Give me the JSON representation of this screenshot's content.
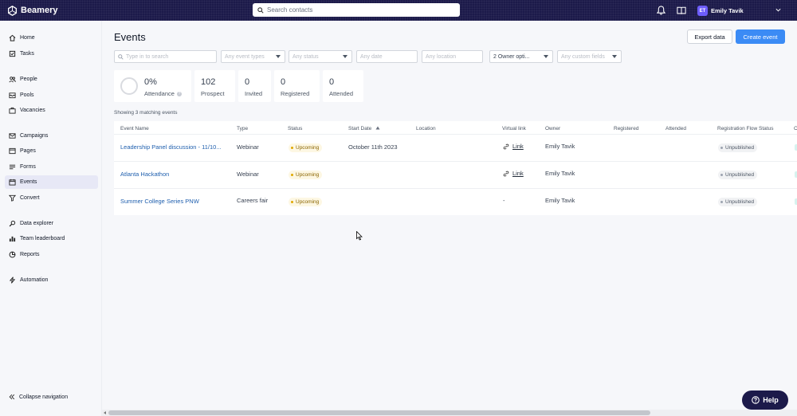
{
  "app": {
    "brand": "Beamery",
    "search_placeholder": "Search contacts",
    "user_initials": "ET",
    "user_name": "Emily Tavik"
  },
  "sidebar": {
    "items": [
      {
        "label": "Home",
        "icon": "home-icon"
      },
      {
        "label": "Tasks",
        "icon": "tasks-icon"
      },
      {
        "label": "People",
        "icon": "people-icon"
      },
      {
        "label": "Pools",
        "icon": "pools-icon"
      },
      {
        "label": "Vacancies",
        "icon": "vacancies-icon"
      },
      {
        "label": "Campaigns",
        "icon": "campaigns-icon"
      },
      {
        "label": "Pages",
        "icon": "pages-icon"
      },
      {
        "label": "Forms",
        "icon": "forms-icon"
      },
      {
        "label": "Events",
        "icon": "calendar-icon",
        "active": true
      },
      {
        "label": "Convert",
        "icon": "funnel-icon"
      },
      {
        "label": "Data explorer",
        "icon": "data-explorer-icon"
      },
      {
        "label": "Team leaderboard",
        "icon": "leaderboard-icon"
      },
      {
        "label": "Reports",
        "icon": "reports-icon"
      },
      {
        "label": "Automation",
        "icon": "lightning-icon"
      }
    ],
    "collapse_label": "Collapse navigation"
  },
  "page": {
    "title": "Events",
    "export_label": "Export data",
    "create_label": "Create event"
  },
  "filters": {
    "search_placeholder": "Type in to search",
    "event_types": "Any event types",
    "status": "Any status",
    "date": "Any date",
    "location": "Any location",
    "owner": "2 Owner opti...",
    "custom_fields": "Any custom fields"
  },
  "stats": {
    "attendance_value": "0%",
    "attendance_label": "Attendance",
    "prospect_value": "102",
    "prospect_label": "Prospect",
    "invited_value": "0",
    "invited_label": "Invited",
    "registered_value": "0",
    "registered_label": "Registered",
    "attended_value": "0",
    "attended_label": "Attended"
  },
  "matching_text": "Showing 3 matching events",
  "table": {
    "columns": [
      "Event Name",
      "Type",
      "Status",
      "Start Date",
      "Location",
      "Virtual link",
      "Owner",
      "Registered",
      "Attended",
      "Registration Flow Status",
      "C"
    ],
    "rows": [
      {
        "name": "Leadership Panel discussion - 11/10...",
        "type": "Webinar",
        "status": "Upcoming",
        "start_date": "October 11th 2023",
        "location": "",
        "virtual_link": "Link",
        "owner": "Emily Tavik",
        "registered": "",
        "attended": "",
        "flow_status": "Unpublished"
      },
      {
        "name": "Atlanta Hackathon",
        "type": "Webinar",
        "status": "Upcoming",
        "start_date": "",
        "location": "",
        "virtual_link": "Link",
        "owner": "Emily Tavik",
        "registered": "",
        "attended": "",
        "flow_status": "Unpublished"
      },
      {
        "name": "Summer College Series PNW",
        "type": "Careers fair",
        "status": "Upcoming",
        "start_date": "",
        "location": "",
        "virtual_link": "-",
        "owner": "Emily Tavik",
        "registered": "",
        "attended": "",
        "flow_status": "Unpublished"
      }
    ]
  },
  "help_label": "Help",
  "colors": {
    "topbar": "#1c1a4a",
    "accent": "#3b8bf5",
    "link": "#1f5fae",
    "upcoming_bg": "#fdf7e3"
  }
}
